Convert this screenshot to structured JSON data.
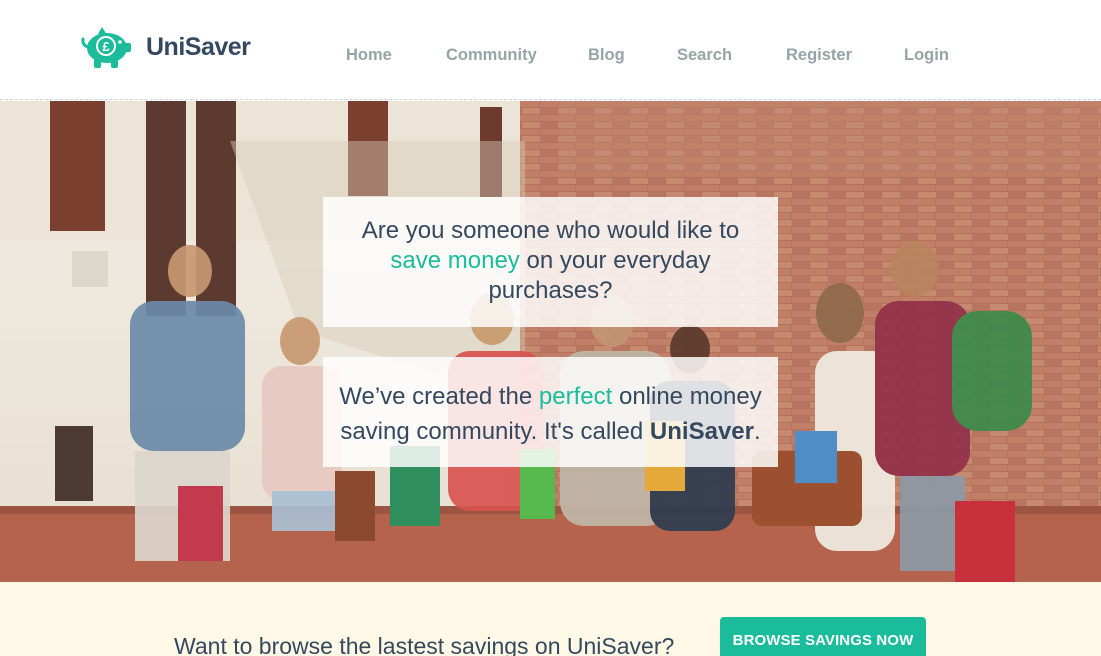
{
  "header": {
    "brand": "UniSaver",
    "nav": [
      {
        "label": "Home"
      },
      {
        "label": "Community"
      },
      {
        "label": "Blog"
      },
      {
        "label": "Search"
      },
      {
        "label": "Register"
      },
      {
        "label": "Login"
      }
    ]
  },
  "hero": {
    "card1": {
      "line1": "Are you someone who would like to",
      "highlight": "save money",
      "line2_rest": " on your everyday",
      "line3": "purchases?"
    },
    "card2": {
      "line1_prefix": "We’ve created the ",
      "highlight": "perfect",
      "line1_suffix": " online money",
      "line2_prefix": "saving community. It's called ",
      "brand": "UniSaver",
      "line2_suffix": "."
    }
  },
  "cta": {
    "text": "Want to browse the lastest savings on UniSaver?",
    "button": "BROWSE SAVINGS NOW"
  },
  "colors": {
    "accent": "#1abc9c",
    "brand_text": "#34495e",
    "nav_text": "#95a5a6",
    "cta_background": "#fef8e6"
  },
  "icons": {
    "logo": "piggy-bank-pound-icon"
  }
}
